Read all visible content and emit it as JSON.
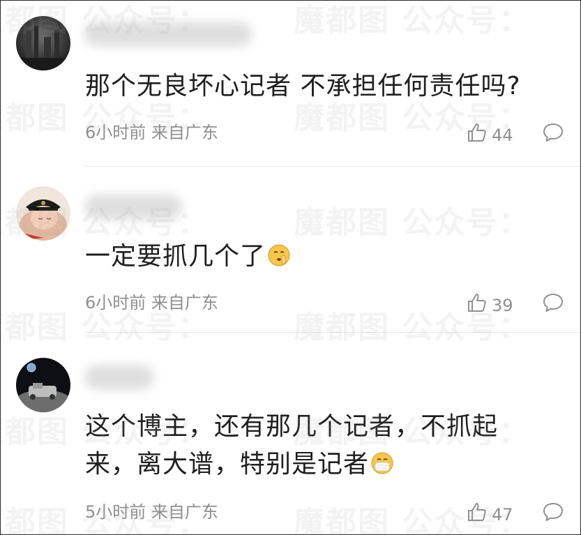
{
  "watermark": {
    "text": "魔都图 公众号："
  },
  "comments": [
    {
      "text": "那个无良坏心记者 不承担任何责任吗?",
      "time": "6小时前",
      "location": "来自广东",
      "likes": "44",
      "emoji": ""
    },
    {
      "text": "一定要抓几个了",
      "time": "6小时前",
      "location": "来自广东",
      "likes": "39",
      "emoji": "shushing-face-emoji"
    },
    {
      "text_line1": "这个博主，还有那几个记者，不抓起",
      "text_line2": "来，离大谱，特别是记者",
      "time": "5小时前",
      "location": "来自广东",
      "likes": "47",
      "emoji": "mask-face-emoji"
    }
  ],
  "icons": {
    "like": "thumbs-up-icon",
    "reply": "comment-bubble-icon"
  },
  "colors": {
    "text": "#1f1f1f",
    "meta": "#8f8f8f",
    "divider": "#e6e6e6"
  }
}
